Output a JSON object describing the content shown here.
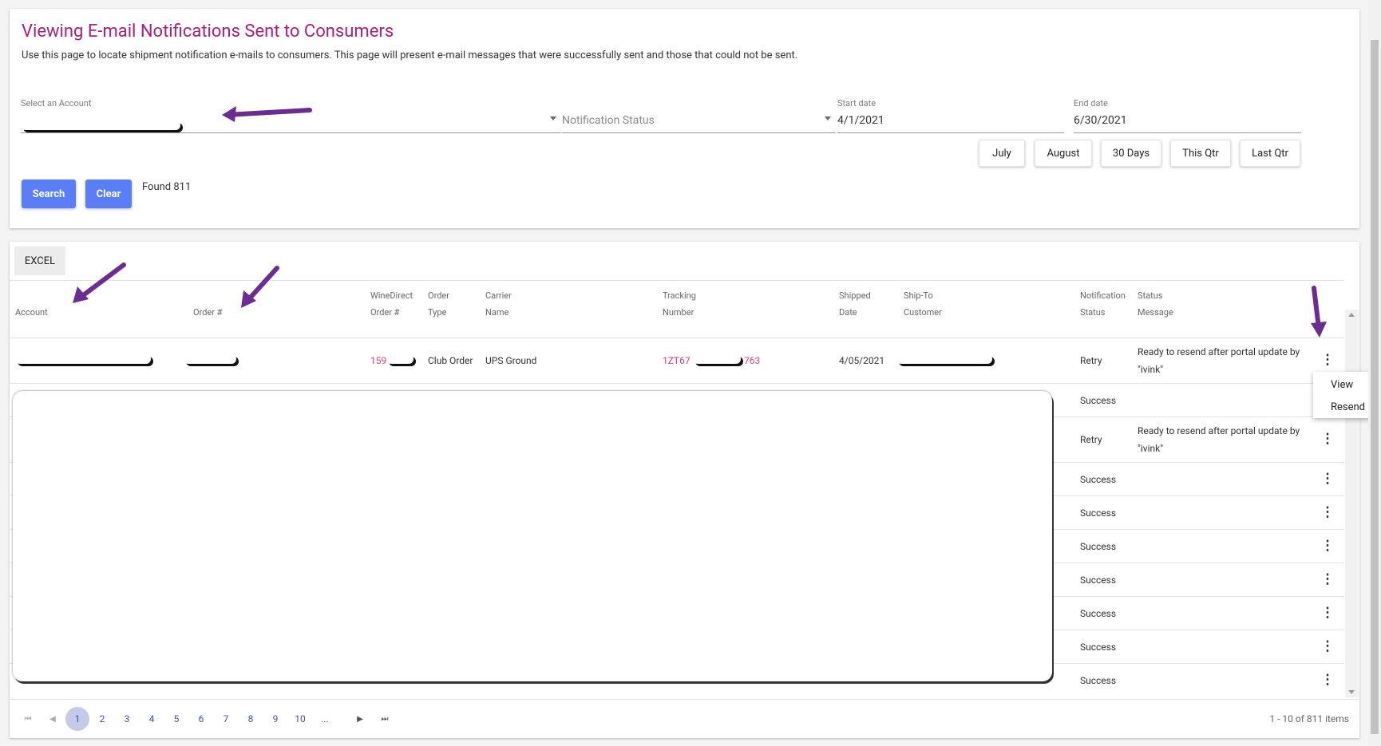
{
  "header": {
    "title": "Viewing E-mail Notifications Sent to Consumers",
    "subtitle": "Use this page to locate shipment notification e-mails to consumers. This page will present e-mail messages that were successfully sent and those that could not be sent."
  },
  "filters": {
    "account_label": "Select an Account",
    "notification_status_placeholder": "Notification Status",
    "start_date_label": "Start date",
    "start_date_value": "4/1/2021",
    "end_date_label": "End date",
    "end_date_value": "6/30/2021",
    "quick_ranges": [
      "July",
      "August",
      "30 Days",
      "This Qtr",
      "Last Qtr"
    ],
    "search_label": "Search",
    "clear_label": "Clear",
    "found_text": "Found 811"
  },
  "grid": {
    "excel_label": "EXCEL",
    "columns": [
      {
        "l1": "",
        "l2": "Account"
      },
      {
        "l1": "",
        "l2": "Order #"
      },
      {
        "l1": "WineDirect",
        "l2": "Order #"
      },
      {
        "l1": "Order",
        "l2": "Type"
      },
      {
        "l1": "Carrier",
        "l2": "Name"
      },
      {
        "l1": "Tracking",
        "l2": "Number"
      },
      {
        "l1": "Shipped",
        "l2": "Date"
      },
      {
        "l1": "Ship-To",
        "l2": "Customer"
      },
      {
        "l1": "Notification",
        "l2": "Status"
      },
      {
        "l1": "Status",
        "l2": "Message"
      }
    ],
    "first_row": {
      "winedirect_order": "159",
      "order_type": "Club Order",
      "carrier": "UPS Ground",
      "tracking_prefix": "1ZT67",
      "tracking_suffix": "763",
      "shipped_date": "4/05/2021",
      "status": "Retry",
      "message": "Ready to resend after portal update by \"ivink\""
    },
    "rows": [
      {
        "status": "Success",
        "message": ""
      },
      {
        "status": "Retry",
        "message": "Ready to resend after portal update by \"ivink\""
      },
      {
        "status": "Success",
        "message": ""
      },
      {
        "status": "Success",
        "message": ""
      },
      {
        "status": "Success",
        "message": ""
      },
      {
        "status": "Success",
        "message": ""
      },
      {
        "status": "Success",
        "message": ""
      },
      {
        "status": "Success",
        "message": ""
      },
      {
        "status": "Success",
        "message": ""
      }
    ],
    "row_menu": {
      "view": "View",
      "resend": "Resend"
    }
  },
  "pager": {
    "pages": [
      "1",
      "2",
      "3",
      "4",
      "5",
      "6",
      "7",
      "8",
      "9",
      "10",
      "..."
    ],
    "current": "1",
    "info": "1 - 10 of 811 items"
  },
  "colors": {
    "title": "#a8217e",
    "primary_button": "#5a7ef7",
    "link": "#e23d73",
    "annotation_arrow": "#6b2d91"
  }
}
